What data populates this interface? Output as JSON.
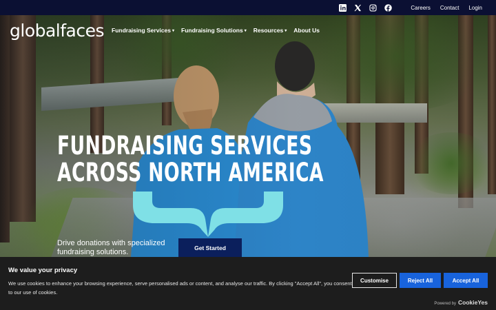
{
  "topbar": {
    "social": [
      "linkedin-icon",
      "x-icon",
      "instagram-icon",
      "facebook-icon"
    ],
    "links": [
      "Careers",
      "Contact",
      "Login"
    ]
  },
  "nav": {
    "logo": "globalfaces",
    "menu": [
      {
        "label": "Fundraising Services",
        "dropdown": true
      },
      {
        "label": "Fundraising Solutions",
        "dropdown": true
      },
      {
        "label": "Resources",
        "dropdown": true
      },
      {
        "label": "About Us",
        "dropdown": false
      }
    ]
  },
  "hero": {
    "headline_line1": "FUNDRAISING SERVICES",
    "headline_line2": "ACROSS NORTH AMERICA",
    "subtext": "Drive donations with specialized fundraising solutions.",
    "cta_label": "Get Started"
  },
  "cookie": {
    "title": "We value your privacy",
    "text": "We use cookies to enhance your browsing experience, serve personalised ads or content, and analyse our traffic. By clicking \"Accept All\", you consent to our use of cookies.",
    "customise_label": "Customise",
    "reject_label": "Reject All",
    "accept_label": "Accept All",
    "powered_prefix": "Powered by",
    "powered_brand": "CookieYes"
  },
  "colors": {
    "topbar": "#0b1033",
    "brace": "#7fe0e6",
    "cta": "#0b1f5c",
    "cookie_bg": "#1d1d1d",
    "cookie_btn": "#1863dc"
  }
}
